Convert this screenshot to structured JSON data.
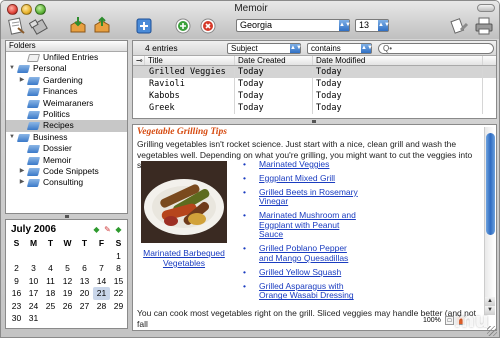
{
  "window": {
    "title": "Memoir"
  },
  "toolbar": {
    "font_value": "Georgia",
    "size_value": "13",
    "icons": [
      "new-note-icon",
      "delete-icon",
      "import-icon",
      "export-icon",
      "add-entry-icon",
      "next-icon",
      "stop-icon",
      "tools-icon",
      "print-icon"
    ]
  },
  "sidebar": {
    "header": "Folders",
    "items": [
      {
        "label": "Unfiled Entries",
        "level": 1,
        "icon": "white"
      },
      {
        "label": "Personal",
        "level": 0,
        "icon": "blue",
        "expanded": true
      },
      {
        "label": "Gardening",
        "level": 1,
        "icon": "blue",
        "has_children": true
      },
      {
        "label": "Finances",
        "level": 1,
        "icon": "blue"
      },
      {
        "label": "Weimaraners",
        "level": 1,
        "icon": "blue"
      },
      {
        "label": "Politics",
        "level": 1,
        "icon": "blue"
      },
      {
        "label": "Recipes",
        "level": 1,
        "icon": "blue",
        "selected": true
      },
      {
        "label": "Business",
        "level": 0,
        "icon": "blue",
        "expanded": true
      },
      {
        "label": "Dossier",
        "level": 1,
        "icon": "blue"
      },
      {
        "label": "Memoir",
        "level": 1,
        "icon": "blue"
      },
      {
        "label": "Code Snippets",
        "level": 1,
        "icon": "blue",
        "has_children": true
      },
      {
        "label": "Consulting",
        "level": 1,
        "icon": "blue",
        "has_children": true
      }
    ]
  },
  "calendar": {
    "title": "July 2006",
    "weekdays": [
      "S",
      "M",
      "T",
      "W",
      "T",
      "F",
      "S"
    ],
    "weeks": [
      [
        "",
        "",
        "",
        "",
        "",
        "",
        "1"
      ],
      [
        "2",
        "3",
        "4",
        "5",
        "6",
        "7",
        "8"
      ],
      [
        "9",
        "10",
        "11",
        "12",
        "13",
        "14",
        "15"
      ],
      [
        "16",
        "17",
        "18",
        "19",
        "20",
        "21",
        "22"
      ],
      [
        "23",
        "24",
        "25",
        "26",
        "27",
        "28",
        "29"
      ],
      [
        "30",
        "31",
        "",
        "",
        "",
        "",
        ""
      ]
    ],
    "today": "21"
  },
  "list": {
    "count_label": "4 entries",
    "filter_field": "Subject",
    "filter_op": "contains",
    "search_placeholder": "Q•",
    "columns": {
      "title": "Title",
      "created": "Date Created",
      "modified": "Date Modified"
    },
    "rows": [
      {
        "title": "Grilled Veggies",
        "created": "Today",
        "modified": "Today"
      },
      {
        "title": "Ravioli",
        "created": "Today",
        "modified": "Today"
      },
      {
        "title": "Kabobs",
        "created": "Today",
        "modified": "Today"
      },
      {
        "title": "Greek",
        "created": "Today",
        "modified": "Today"
      }
    ]
  },
  "note": {
    "title": "Vegetable Grilling Tips",
    "intro": "Grilling vegetables isn't rocket science. Just start with a nice, clean grill and wash the vegetables well. Depending on what you're grilling, you might want to cut the veggies into smaller pieces.",
    "photo_caption": "Marinated Barbequed Vegetables",
    "links": [
      "Marinated Veggies",
      "Eggplant Mixed Grill",
      "Grilled Beets in Rosemary Vinegar",
      "Marinated Mushroom and Eggplant with Peanut Sauce",
      "Grilled Poblano Pepper and Mango Quesadillas",
      "Grilled Yellow Squash",
      "Grilled Asparagus with Orange Wasabi Dressing"
    ],
    "bottom_text": "You can cook most vegetables right on the grill. Sliced veggies may handle better (and not fall",
    "zoom": "100%"
  },
  "watermark": "mu"
}
